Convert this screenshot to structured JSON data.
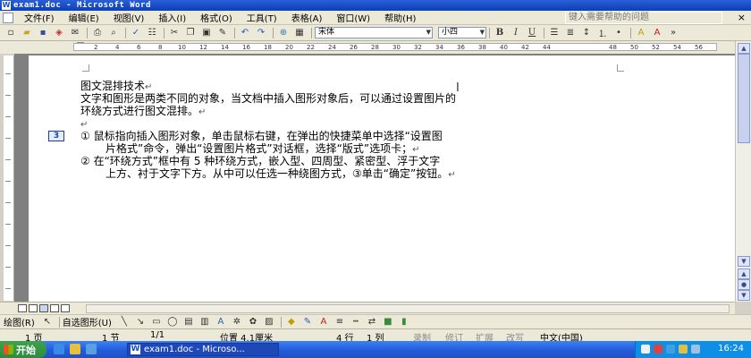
{
  "window": {
    "title": "exam1.doc - Microsoft Word"
  },
  "menu": {
    "items": [
      "文件(F)",
      "编辑(E)",
      "视图(V)",
      "插入(I)",
      "格式(O)",
      "工具(T)",
      "表格(A)",
      "窗口(W)",
      "帮助(H)"
    ],
    "help_placeholder": "键入需要帮助的问题",
    "close_label": "×"
  },
  "toolbar": {
    "font_name": "宋体",
    "font_size": "小四",
    "bold": "B",
    "italic": "I",
    "underline": "U",
    "icons": [
      "new-icon",
      "open-icon",
      "save-icon",
      "permission-icon",
      "email-icon",
      "print-icon",
      "print-preview-icon",
      "spelling-icon",
      "research-icon",
      "cut-icon",
      "copy-icon",
      "paste-icon",
      "format-painter-icon",
      "undo-icon",
      "redo-icon",
      "hyperlink-icon",
      "table-icon"
    ]
  },
  "ruler": {
    "ticks": [
      "2",
      "4",
      "6",
      "8",
      "10",
      "12",
      "14",
      "16",
      "18",
      "20",
      "22",
      "24",
      "26",
      "28",
      "30",
      "32",
      "34",
      "36",
      "38",
      "40",
      "42",
      "44",
      "48",
      "50",
      "52",
      "54",
      "56"
    ]
  },
  "document": {
    "heading": "图文混排技术",
    "intro_line1": "文字和图形是两类不同的对象，当文档中插入图形对象后，可以通过设置图片的",
    "intro_line2": "环绕方式进行图文混排。",
    "note_marker": "3",
    "step1_line1": "①  鼠标指向插入图形对象，单击鼠标右键，在弹出的快捷菜单中选择“设置图",
    "step1_line2": "片格式”命令，弹出“设置图片格式”对话框，选择“版式”选项卡；",
    "step2_line1": "②  在“环绕方式”框中有 5 种环绕方式，嵌入型、四周型、紧密型、浮于文字",
    "step2_line2": "上方、衬于文字下方。从中可以任选一种绕图方式，③单击“确定”按钮。",
    "para_mark": "↵"
  },
  "drawing": {
    "draw_label": "绘图(R)",
    "autoshapes_label": "自选图形(U)"
  },
  "status": {
    "page": "1 页",
    "section": "1 节",
    "page_of": "1/1",
    "position": "位置 4.1厘米",
    "line": "4 行",
    "column": "1 列",
    "rec": "录制",
    "trk": "修订",
    "ext": "扩展",
    "ovr": "改写",
    "language": "中文(中国)"
  },
  "taskbar": {
    "start": "开始",
    "task": "exam1.doc - Microso...",
    "clock": "16:24"
  }
}
